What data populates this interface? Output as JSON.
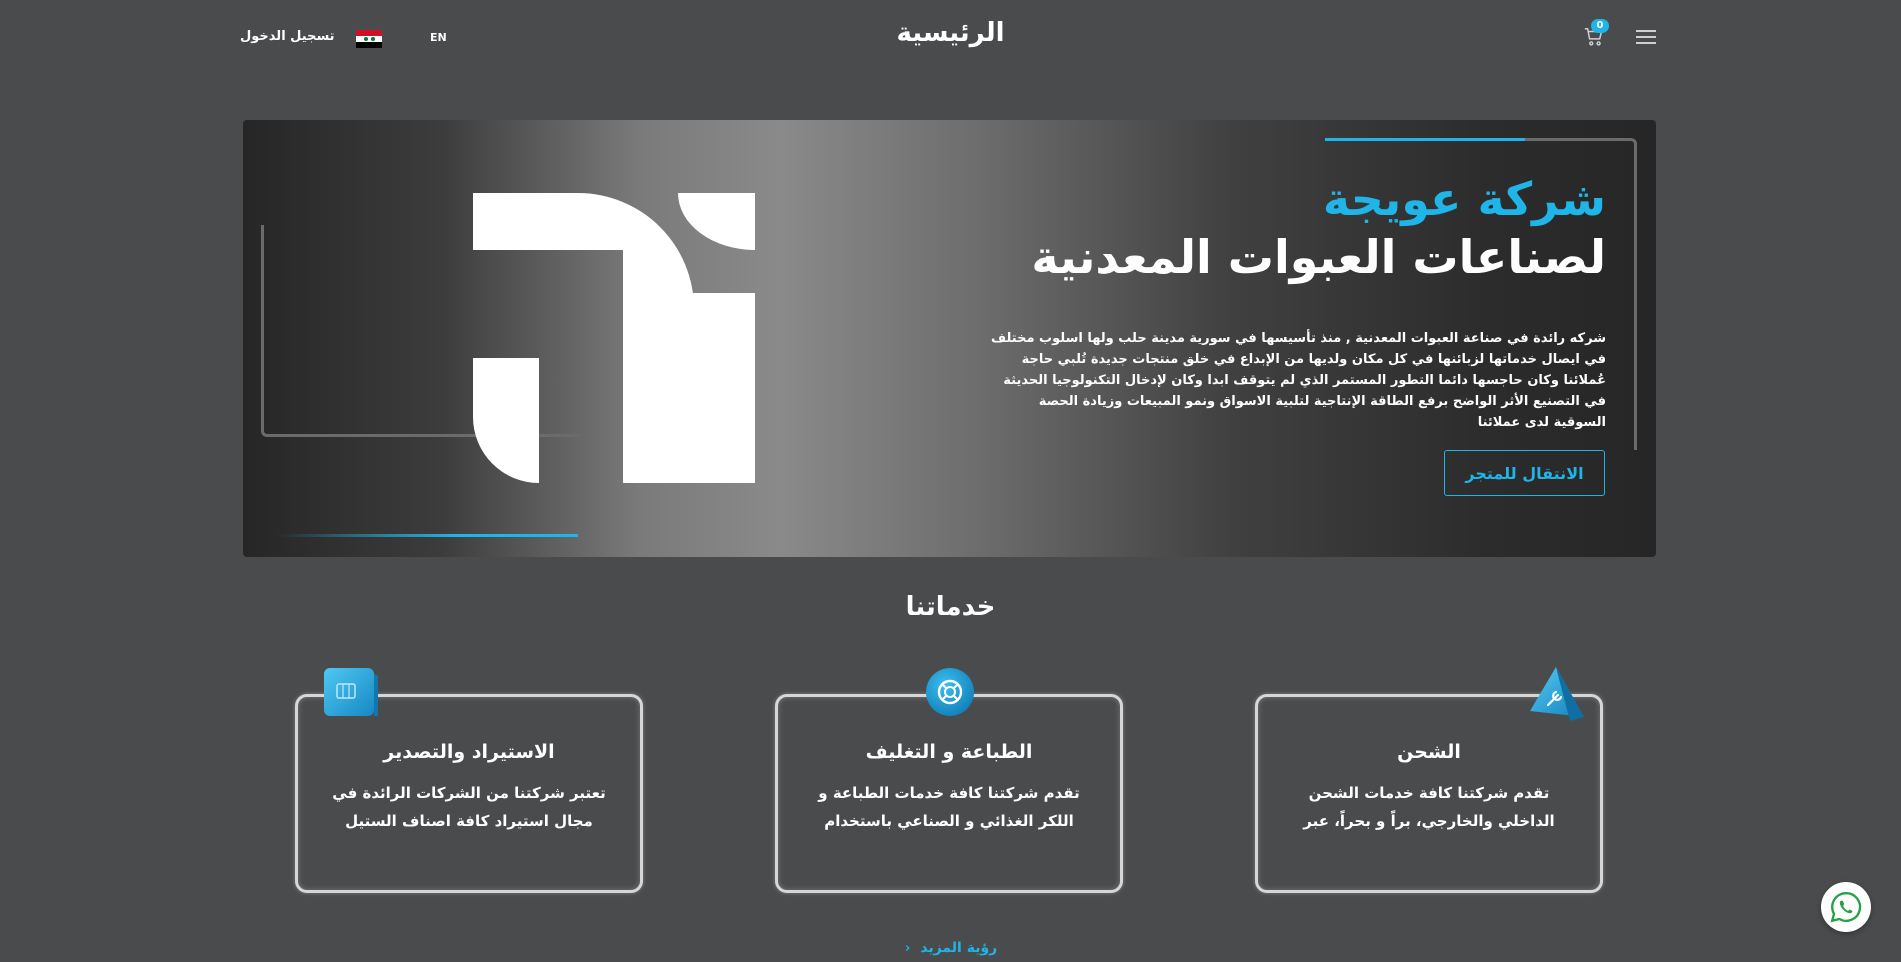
{
  "header": {
    "title": "الرئيسية",
    "login_label": "تسجيل الدخول",
    "lang_label": "EN",
    "cart_count": "0"
  },
  "hero": {
    "title_line1": "شركة عويجة",
    "title_line2": "لصناعات العبوات المعدنية",
    "description": "شركه رائدة في صناعة العبوات المعدنية , منذ تأسيسها في سورية مدينة حلب ولها اسلوب مختلف في ايصال خدماتها لزبائنها في كل مكان ولديها من الإبداع في خلق منتجات جديدة تُلبي حاجة عُملائنا وكان حاجسها دائما التطور المستمر الذي لم يتوقف ابدا وكان لإدخال التكنولوجيا الحديثة في التصنيع الأثر الواضح برفع الطاقة الإنتاجية لتلبية الاسواق ونمو المبيعات وزيادة الحصة السوقية لدى عملائنا",
    "shop_button": "الانتقال للمتجر"
  },
  "services": {
    "title": "خدماتنا",
    "cards": [
      {
        "title": "الاستيراد والتصدير",
        "text": "تعتبر شركتنا من الشركات الرائدة في مجال استيراد كافة اصناف الستيل",
        "icon": "box-icon"
      },
      {
        "title": "الطباعة و التغليف",
        "text": "تقدم شركتنا كافة خدمات الطباعة و اللكر الغذائي و الصناعي باستخدام",
        "icon": "lifebuoy-icon"
      },
      {
        "title": "الشحن",
        "text": "تقدم شركتنا كافة خدمات الشحن الداخلي والخارجي، براً و بحراً، عبر",
        "icon": "wrench-icon"
      }
    ],
    "see_more": "رؤية المزيد"
  },
  "colors": {
    "accent": "#1fb5e8",
    "background": "#4a4b4d"
  }
}
